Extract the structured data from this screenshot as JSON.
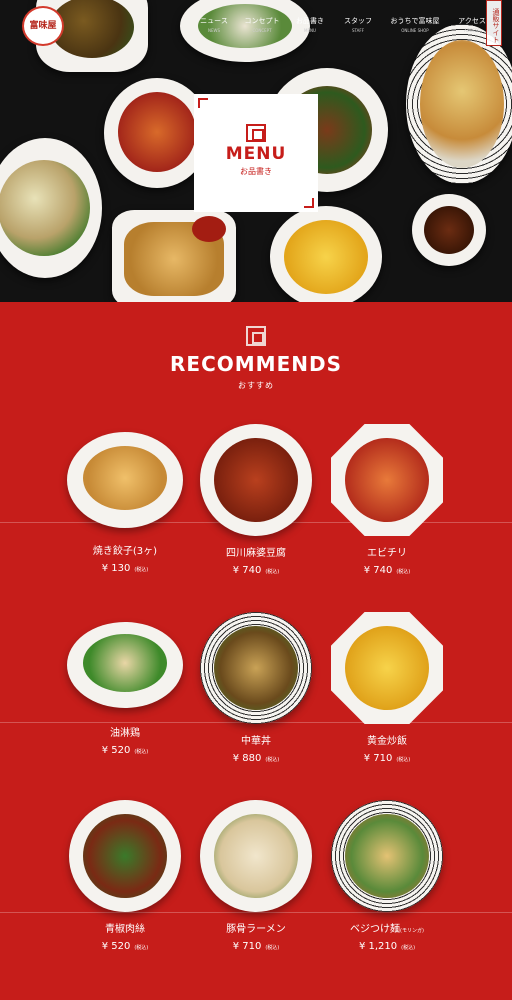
{
  "brand": {
    "logo_text": "富味屋"
  },
  "nav": {
    "items": [
      {
        "label": "ニュース",
        "en": "NEWS"
      },
      {
        "label": "コンセプト",
        "en": "CONCEPT"
      },
      {
        "label": "お品書き",
        "en": "MENU"
      },
      {
        "label": "スタッフ",
        "en": "STAFF"
      },
      {
        "label": "おうちで富味屋",
        "en": "ONLINE SHOP"
      },
      {
        "label": "アクセス",
        "en": "ACCESS"
      }
    ],
    "shop_tab": "通販サイト"
  },
  "hero": {
    "title": "MENU",
    "subtitle": "お品書き"
  },
  "recommends": {
    "title": "RECOMMENDS",
    "subtitle": "おすすめ",
    "tax_label": "(税込)",
    "items": [
      {
        "name": "焼き餃子(3ヶ)",
        "price": "¥ 130"
      },
      {
        "name": "四川麻婆豆腐",
        "price": "¥ 740"
      },
      {
        "name": "エビチリ",
        "price": "¥ 740"
      },
      {
        "name": "油淋鶏",
        "price": "¥ 520"
      },
      {
        "name": "中華丼",
        "price": "¥ 880"
      },
      {
        "name": "黄金炒飯",
        "price": "¥ 710"
      },
      {
        "name": "青椒肉絲",
        "price": "¥ 520"
      },
      {
        "name": "豚骨ラーメン",
        "price": "¥ 710"
      },
      {
        "name": "ベジつけ麺",
        "name_note": "(モリンガ)",
        "price": "¥ 1,210"
      }
    ]
  },
  "colors": {
    "accent": "#c61d1a",
    "background": "#c61d1a",
    "text": "#ffffff"
  }
}
